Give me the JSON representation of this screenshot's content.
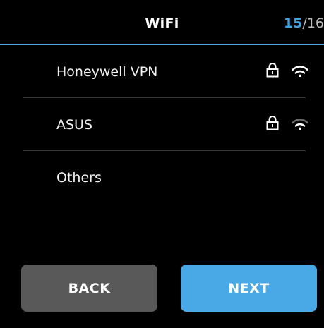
{
  "header": {
    "title": "WiFi",
    "page_current": "15",
    "page_separator": "/",
    "page_total": "16",
    "accent_color": "#3fa3e0"
  },
  "networks": [
    {
      "name": "Honeywell VPN",
      "secured": true,
      "lock_icon": "lock-icon",
      "signal_icon": "wifi-signal-icon",
      "signal_level": "strong"
    },
    {
      "name": "ASUS",
      "secured": true,
      "lock_icon": "lock-icon",
      "signal_icon": "wifi-signal-icon",
      "signal_level": "medium"
    },
    {
      "name": "Others",
      "secured": false
    }
  ],
  "buttons": {
    "back_label": "BACK",
    "next_label": "NEXT",
    "back_color": "#595959",
    "next_color": "#49a8e6"
  }
}
